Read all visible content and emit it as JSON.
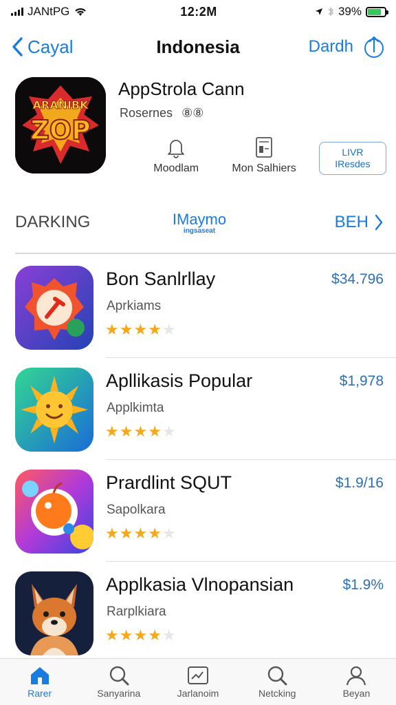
{
  "status": {
    "carrier": "JANtPG",
    "time": "12:2M",
    "battery": "39%"
  },
  "nav": {
    "back_label": "Cayal",
    "title": "Indonesia",
    "right_label": "Dardh"
  },
  "featured": {
    "name": "AppStrola Cann",
    "rating_text": "Rosernes",
    "rating_badge": "⑧⑧",
    "icon_text_top": "ARANIBK",
    "icon_text_main": "ZOP",
    "actions": {
      "notify_label": "Moodlam",
      "similar_label": "Mon Salhiers",
      "button_line1": "LIVR",
      "button_line2": "IResdes"
    }
  },
  "section": {
    "title": "DARKING",
    "center_main": "IMaymo",
    "center_sub": "ingsaseat",
    "more_label": "BEH"
  },
  "apps": [
    {
      "name": "Bon Sanlrllay",
      "subtitle": "Aprkiams",
      "price": "$34.796",
      "rating": 4,
      "icon_colors": [
        "#7a3bd1",
        "#2947b8"
      ]
    },
    {
      "name": "Apllikasis Popular",
      "subtitle": "Applkimta",
      "price": "$1,978",
      "rating": 4,
      "icon_colors": [
        "#2fcf8e",
        "#1b6fd8"
      ]
    },
    {
      "name": "Prardlint SQUT",
      "subtitle": "Sapolkara",
      "price": "$1.9/16",
      "rating": 4,
      "icon_colors": [
        "#ff4f6e",
        "#4f3ee0"
      ]
    },
    {
      "name": "Applkasia Vlnopansian",
      "subtitle": "Rarplkiara",
      "price": "$1.9%",
      "rating": 4,
      "icon_colors": [
        "#1b2746",
        "#0f1830"
      ]
    }
  ],
  "tabs": [
    {
      "label": "Rarer",
      "icon": "house-icon",
      "active": true
    },
    {
      "label": "Sanyarina",
      "icon": "search-icon",
      "active": false
    },
    {
      "label": "Jarlanoim",
      "icon": "image-icon",
      "active": false
    },
    {
      "label": "Netcking",
      "icon": "search-icon",
      "active": false
    },
    {
      "label": "Beyan",
      "icon": "person-icon",
      "active": false
    }
  ],
  "colors": {
    "accent": "#1a7be0",
    "star": "#f6a81c",
    "price": "#2f6fb3",
    "battery": "#34c759"
  }
}
